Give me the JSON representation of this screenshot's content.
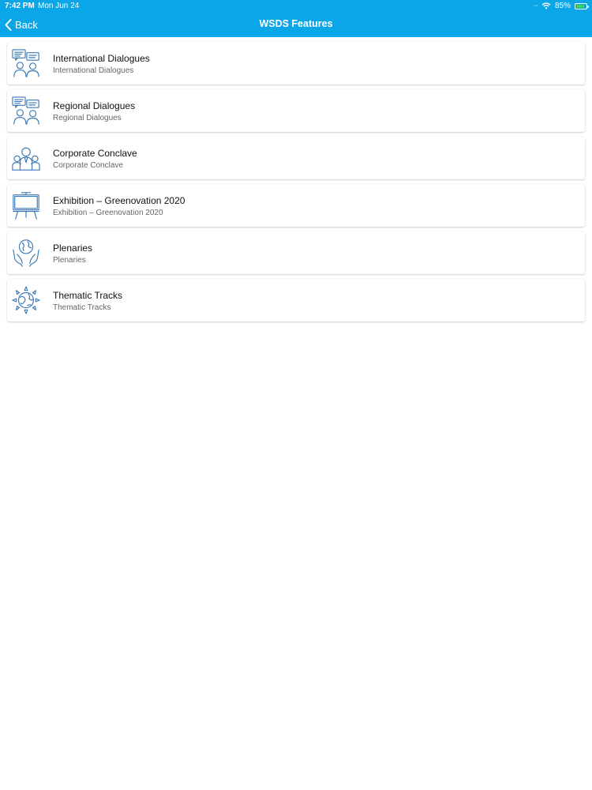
{
  "status_bar": {
    "time": "7:42 PM",
    "date": "Mon Jun 24",
    "battery": "85%",
    "battery_level": 0.85
  },
  "nav": {
    "back_label": "Back",
    "title": "WSDS Features"
  },
  "colors": {
    "accent": "#0aa6e8",
    "icon": "#3a78b5"
  },
  "items": [
    {
      "title": "International Dialogues",
      "subtitle": "International Dialogues",
      "icon": "dialogue-icon"
    },
    {
      "title": "Regional Dialogues",
      "subtitle": "Regional Dialogues",
      "icon": "dialogue-icon"
    },
    {
      "title": "Corporate Conclave",
      "subtitle": "Corporate Conclave",
      "icon": "people-group-icon"
    },
    {
      "title": "Exhibition – Greenovation 2020",
      "subtitle": "Exhibition – Greenovation 2020",
      "icon": "easel-board-icon"
    },
    {
      "title": "Plenaries",
      "subtitle": "Plenaries",
      "icon": "globe-hands-icon"
    },
    {
      "title": "Thematic Tracks",
      "subtitle": "Thematic Tracks",
      "icon": "globe-sun-icon"
    }
  ]
}
